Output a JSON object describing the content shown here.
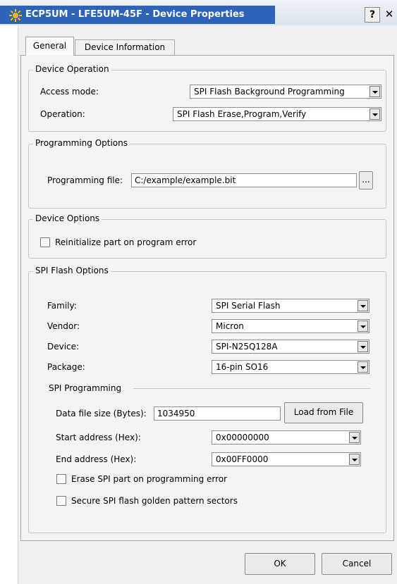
{
  "window": {
    "title": "ECP5UM - LFE5UM-45F - Device Properties",
    "help_label": "?",
    "close_label": "✕"
  },
  "tabs": [
    {
      "label": "General",
      "selected": true
    },
    {
      "label": "Device Information",
      "selected": false
    }
  ],
  "device_operation": {
    "legend": "Device Operation",
    "access_mode_label": "Access mode:",
    "access_mode_value": "SPI Flash Background Programming",
    "operation_label": "Operation:",
    "operation_value": "SPI Flash Erase,Program,Verify"
  },
  "programming_options": {
    "legend": "Programming Options",
    "file_label": "Programming file:",
    "file_value": "C:/example/example.bit",
    "browse_label": "..."
  },
  "device_options": {
    "legend": "Device Options",
    "reinitialize_label": "Reinitialize part on program error",
    "reinitialize_checked": false
  },
  "spi_flash_options": {
    "legend": "SPI Flash Options",
    "family_label": "Family:",
    "family_value": "SPI Serial Flash",
    "vendor_label": "Vendor:",
    "vendor_value": "Micron",
    "device_label": "Device:",
    "device_value": "SPI-N25Q128A",
    "package_label": "Package:",
    "package_value": "16-pin SO16",
    "spi_programming": {
      "heading": "SPI Programming",
      "data_size_label": "Data file size (Bytes):",
      "data_size_value": "1034950",
      "load_button_label": "Load from File",
      "start_label": "Start address (Hex):",
      "start_value": "0x00000000",
      "end_label": "End address (Hex):",
      "end_value": "0x00FF0000",
      "erase_label": "Erase SPI part on programming error",
      "erase_checked": false,
      "secure_label": "Secure SPI flash golden pattern sectors",
      "secure_checked": false
    }
  },
  "footer": {
    "ok_label": "OK",
    "cancel_label": "Cancel"
  }
}
